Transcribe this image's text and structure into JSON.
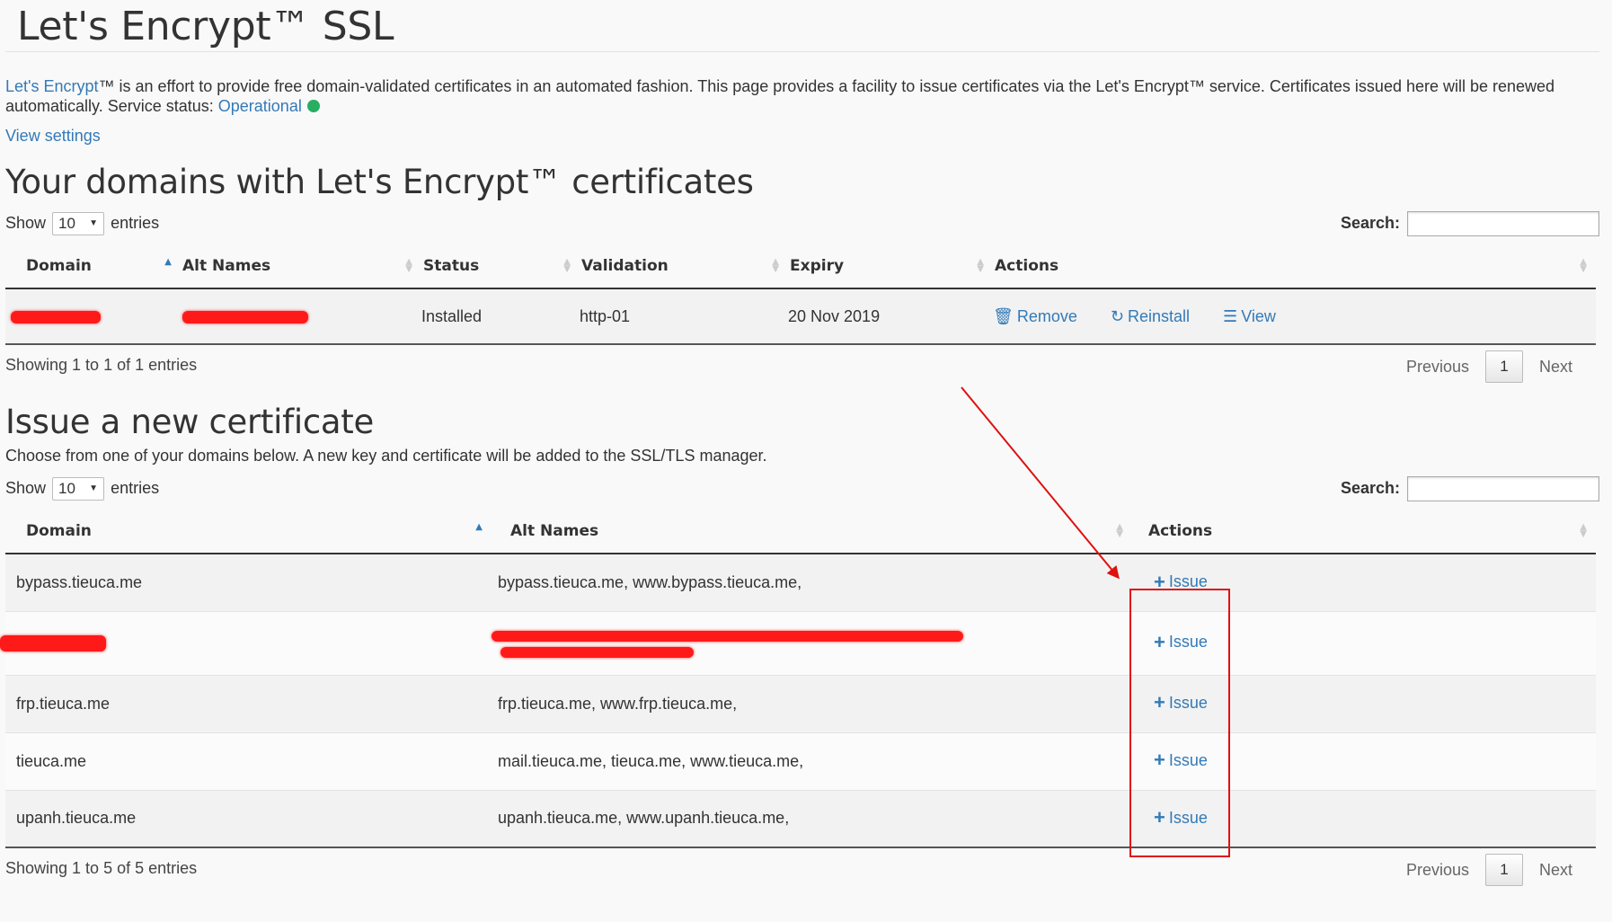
{
  "header": {
    "title": "Let's Encrypt™ SSL"
  },
  "intro": {
    "link_text": "Let's Encrypt",
    "text_after_link": "™ is an effort to provide free domain-validated certificates in an automated fashion. This page provides a facility to issue certificates via the Let's Encrypt™ service. Certificates issued here will be renewed automatically. Service status: ",
    "status_link": "Operational",
    "status_color": "#27ae60",
    "view_settings": "View settings"
  },
  "installed": {
    "heading": "Your domains with Let's Encrypt™ certificates",
    "show_label": "Show",
    "entries_value": "10",
    "entries_label": "entries",
    "search_label": "Search:",
    "columns": [
      "Domain",
      "Alt Names",
      "Status",
      "Validation",
      "Expiry",
      "Actions"
    ],
    "rows": [
      {
        "status": "Installed",
        "validation": "http-01",
        "expiry": "20 Nov 2019"
      }
    ],
    "actions": {
      "remove": "Remove",
      "reinstall": "Reinstall",
      "view": "View"
    },
    "info": "Showing 1 to 1 of 1 entries",
    "prev": "Previous",
    "page": "1",
    "next": "Next"
  },
  "issue": {
    "heading": "Issue a new certificate",
    "desc": "Choose from one of your domains below. A new key and certificate will be added to the SSL/TLS manager.",
    "show_label": "Show",
    "entries_value": "10",
    "entries_label": "entries",
    "search_label": "Search:",
    "columns": [
      "Domain",
      "Alt Names",
      "Actions"
    ],
    "rows": [
      {
        "domain": "bypass.tieuca.me",
        "alt": "bypass.tieuca.me, www.bypass.tieuca.me,"
      },
      {
        "domain": "",
        "alt": ""
      },
      {
        "domain": "frp.tieuca.me",
        "alt": "frp.tieuca.me, www.frp.tieuca.me,"
      },
      {
        "domain": "tieuca.me",
        "alt": "mail.tieuca.me, tieuca.me, www.tieuca.me,"
      },
      {
        "domain": "upanh.tieuca.me",
        "alt": "upanh.tieuca.me, www.upanh.tieuca.me,"
      }
    ],
    "issue_label": "Issue",
    "info": "Showing 1 to 5 of 5 entries",
    "prev": "Previous",
    "page": "1",
    "next": "Next"
  },
  "colors": {
    "link": "#337ab7",
    "annotation": "#e01010"
  }
}
